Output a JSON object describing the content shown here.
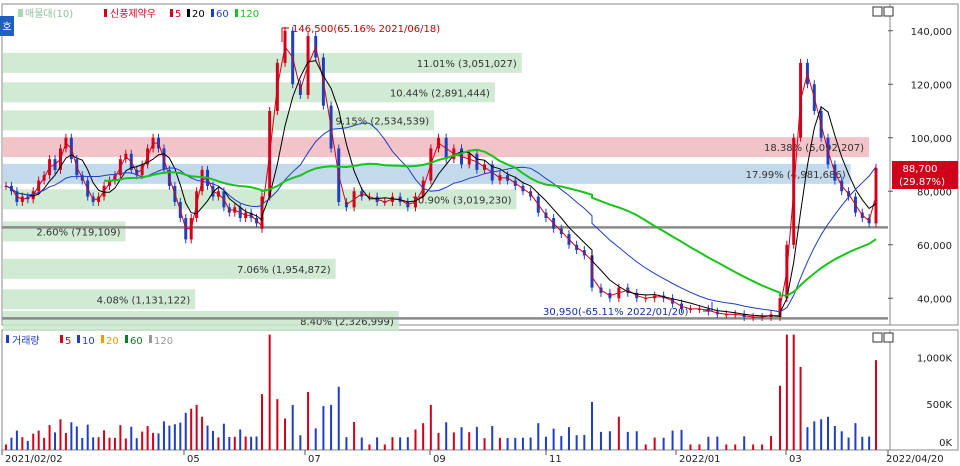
{
  "chart_data": [
    {
      "type": "candlestick",
      "legend": {
        "profile": "매물대(10)",
        "stock": "신풍제약우",
        "ma": [
          {
            "name": "5",
            "color": "#d0021b"
          },
          {
            "name": "20",
            "color": "#000000"
          },
          {
            "name": "60",
            "color": "#1f3fbf"
          },
          {
            "name": "120",
            "color": "#18c418"
          }
        ]
      },
      "side_button": "호",
      "ylim": [
        30000,
        150000
      ],
      "yticks": [
        "140,000",
        "120,000",
        "100,000",
        "80,000",
        "60,000",
        "40,000"
      ],
      "ytick_values": [
        140000,
        120000,
        100000,
        80000,
        60000,
        40000
      ],
      "price_axis_label": {
        "value": "88,700",
        "change": "(29.87%)"
      },
      "volume_profile": [
        {
          "price": 31500,
          "label": "8.40% (2,326,999)",
          "highlight": false
        },
        {
          "price": 39600,
          "label": "4.08% (1,131,122)",
          "highlight": false
        },
        {
          "price": 51000,
          "label": "7.06% (1,954,872)",
          "highlight": false
        },
        {
          "price": 65000,
          "label": "2.60% (719,109)",
          "highlight": false
        },
        {
          "price": 77000,
          "label": "10.90% (3,019,230)",
          "highlight": false
        },
        {
          "price": 86500,
          "label": "17.99% (4,981,686)",
          "highlight": "current"
        },
        {
          "price": 96500,
          "label": "18.38% (5,092,207)",
          "highlight": "max"
        },
        {
          "price": 106500,
          "label": "9.15% (2,534,539)",
          "highlight": false
        },
        {
          "price": 117000,
          "label": "10.44% (2,891,444)",
          "highlight": false
        },
        {
          "price": 128000,
          "label": "11.01% (3,051,027)",
          "highlight": false
        }
      ],
      "annotations": {
        "high": {
          "text": "146,500(65.16% 2021/06/18)",
          "price": 146500
        },
        "low": {
          "text": "30,950(-65.11% 2022/01/20)",
          "price": 30950
        }
      },
      "hlines": [
        66500,
        32500
      ],
      "price_series": [
        [
          82000,
          80000,
          76000,
          78000,
          77000,
          80000,
          84000,
          86000,
          92000,
          88000,
          96000,
          100000,
          92000,
          86000,
          84000,
          78000,
          76000,
          78000,
          82000,
          84000,
          86000,
          92000,
          94000,
          88000,
          86000,
          90000,
          96000,
          100000,
          96000,
          88000,
          82000,
          76000,
          70000,
          62000,
          70000,
          80000,
          88000,
          82000,
          78000,
          80000,
          74000,
          72000,
          74000,
          70000,
          72000,
          70000,
          68000,
          66000
        ],
        [
          78000,
          110000,
          128000,
          140000,
          120000,
          116000,
          138000,
          130000,
          112000,
          96000,
          76000,
          74000,
          80000,
          78000,
          78000,
          76000,
          76000,
          78000,
          76000,
          74000,
          78000,
          84000,
          96000,
          100000,
          92000,
          96000,
          90000,
          94000,
          88000,
          90000,
          84000,
          86000,
          84000,
          82000,
          80000,
          78000,
          72000,
          70000,
          66000,
          64000,
          60000,
          58000,
          56000,
          52000
        ],
        [
          44000,
          42000,
          40000,
          44000,
          42000,
          40000,
          40000,
          41000,
          40000,
          38000,
          36000,
          36000,
          36000,
          35000,
          34000,
          34000,
          34000,
          33000,
          33000,
          33000,
          34000,
          33000
        ],
        [
          40000,
          60000,
          100000,
          128000,
          120000,
          110000,
          100000,
          90000,
          84000,
          80000,
          78000,
          72000,
          70000,
          68000,
          88700
        ]
      ]
    },
    {
      "type": "bar",
      "legend": {
        "title": "거래량",
        "ma": [
          {
            "name": "5",
            "color": "#d0021b"
          },
          {
            "name": "10",
            "color": "#1f3fbf"
          },
          {
            "name": "20",
            "color": "#e8a000"
          },
          {
            "name": "60",
            "color": "#0a7d2a"
          },
          {
            "name": "120",
            "color": "#9a9a9a"
          }
        ]
      },
      "ylim": [
        0,
        1300000
      ],
      "yticks": [
        "1,000K",
        "500K",
        "0K"
      ],
      "ytick_values": [
        1000000,
        500000,
        0
      ],
      "x_dates": [
        "2021/02/02",
        "05",
        "07",
        "09",
        "11",
        "2022/01",
        "03",
        "2022/04/20"
      ]
    }
  ]
}
